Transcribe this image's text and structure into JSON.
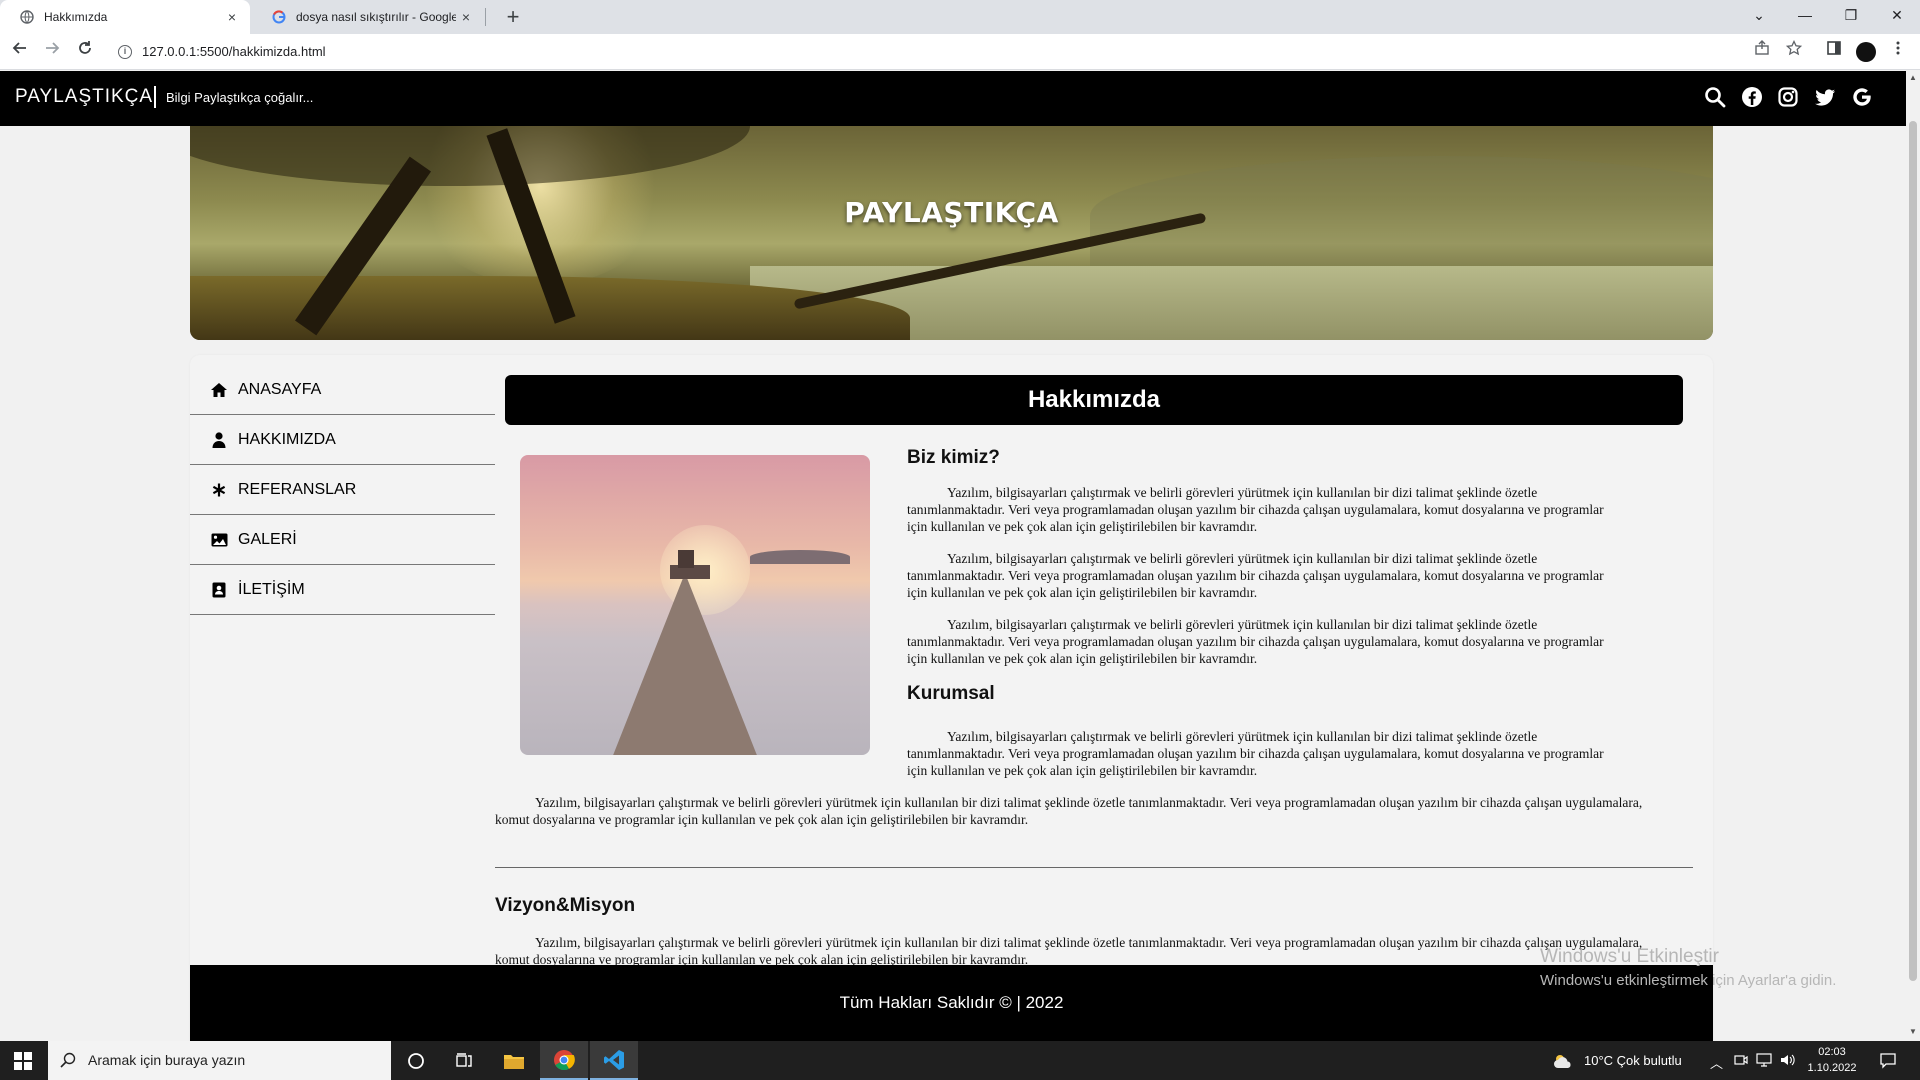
{
  "browser": {
    "tabs": [
      {
        "title": "Hakkımızda",
        "close": "×"
      },
      {
        "title": "dosya nasıl sıkıştırılır - Google'da",
        "close": "×"
      }
    ],
    "new_tab": "+",
    "window_controls": {
      "dropdown": "⌄",
      "minimize": "—",
      "restore": "❐",
      "close": "✕"
    },
    "url": "127.0.0.1:5500/hakkimizda.html"
  },
  "site": {
    "brand": "PAYLAŞTIKÇA",
    "tagline": "Bilgi Paylaştıkça çoğalır...",
    "hero_title": "PAYLAŞTIKÇA",
    "menu": [
      {
        "label": "ANASAYFA",
        "icon": "home-icon"
      },
      {
        "label": "HAKKIMIZDA",
        "icon": "user-icon"
      },
      {
        "label": "REFERANSLAR",
        "icon": "asterisk-icon"
      },
      {
        "label": "GALERİ",
        "icon": "image-icon"
      },
      {
        "label": "İLETİŞİM",
        "icon": "contact-card-icon"
      }
    ],
    "page_title": "Hakkımızda",
    "section_biz": "Biz kimiz?",
    "section_kurumsal": "Kurumsal",
    "section_vizyon": "Vizyon&Misyon",
    "paragraph": "Yazılım, bilgisayarları çalıştırmak ve belirli görevleri yürütmek için kullanılan bir dizi talimat şeklinde özetle tanımlanmaktadır. Veri veya programlamadan oluşan yazılım bir cihazda çalışan uygulamalara, komut dosyalarına ve programlar için kullanılan ve pek çok alan için geliştirilebilen bir kavramdır.",
    "footer": "Tüm Hakları Saklıdır © | 2022"
  },
  "watermark": {
    "line1": "Windows'u Etkinleştir",
    "line2": "Windows'u etkinleştirmek için Ayarlar'a gidin."
  },
  "taskbar": {
    "search_placeholder": "Aramak için buraya yazın",
    "weather": "10°C  Çok bulutlu",
    "time": "02:03",
    "date": "1.10.2022"
  }
}
